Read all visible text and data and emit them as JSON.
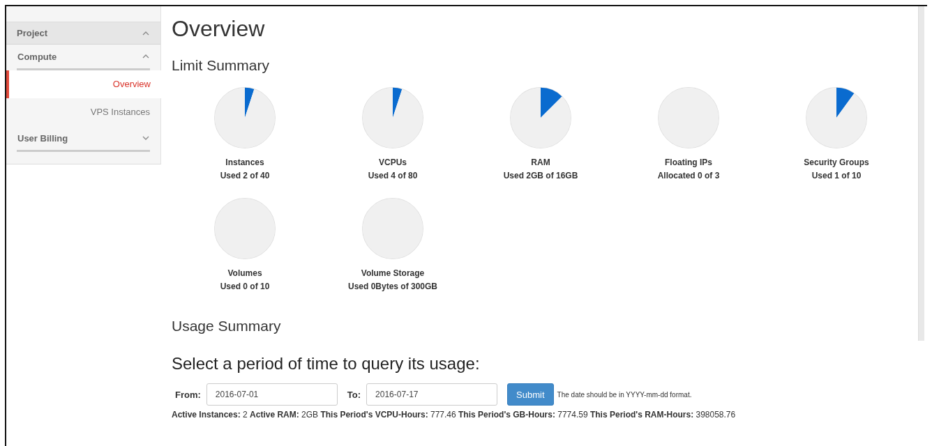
{
  "sidebar": {
    "items": [
      {
        "label": "Project",
        "kind": "panel",
        "expanded": true
      },
      {
        "label": "Compute",
        "kind": "group",
        "expanded": true
      },
      {
        "label": "Overview",
        "kind": "link",
        "selected": true
      },
      {
        "label": "VPS Instances",
        "kind": "link",
        "selected": false
      },
      {
        "label": "User Billing",
        "kind": "group",
        "expanded": false
      }
    ]
  },
  "page_title": "Overview",
  "limit_summary": {
    "heading": "Limit Summary",
    "limits": [
      {
        "name": "Instances",
        "usage": "Used 2 of 40",
        "chart_data": {
          "type": "pie",
          "values": [
            5,
            95
          ]
        }
      },
      {
        "name": "VCPUs",
        "usage": "Used 4 of 80",
        "chart_data": {
          "type": "pie",
          "values": [
            5,
            95
          ]
        }
      },
      {
        "name": "RAM",
        "usage": "Used 2GB of 16GB",
        "chart_data": {
          "type": "pie",
          "values": [
            12.5,
            87.5
          ]
        }
      },
      {
        "name": "Floating IPs",
        "usage": "Allocated 0 of 3",
        "chart_data": {
          "type": "pie",
          "values": [
            0,
            100
          ]
        }
      },
      {
        "name": "Security Groups",
        "usage": "Used 1 of 10",
        "chart_data": {
          "type": "pie",
          "values": [
            10,
            90
          ]
        }
      },
      {
        "name": "Volumes",
        "usage": "Used 0 of 10",
        "chart_data": {
          "type": "pie",
          "values": [
            0,
            100
          ]
        }
      },
      {
        "name": "Volume Storage",
        "usage": "Used 0Bytes of 300GB",
        "chart_data": {
          "type": "pie",
          "values": [
            0,
            100
          ]
        }
      }
    ]
  },
  "usage_summary": {
    "heading": "Usage Summary",
    "subheading": "Select a period of time to query its usage:",
    "from_label": "From:",
    "from_value": "2016-07-01",
    "to_label": "To:",
    "to_value": "2016-07-17",
    "submit": "Submit",
    "hint": "The date should be in YYYY-mm-dd format.",
    "stats": "**Active Instances:** 2 **Active RAM:** 2GB **This Period's VCPU-Hours:** 777.46 **This Period's GB-Hours:** 7774.59 **This Period's RAM-Hours:** 398058.76"
  }
}
